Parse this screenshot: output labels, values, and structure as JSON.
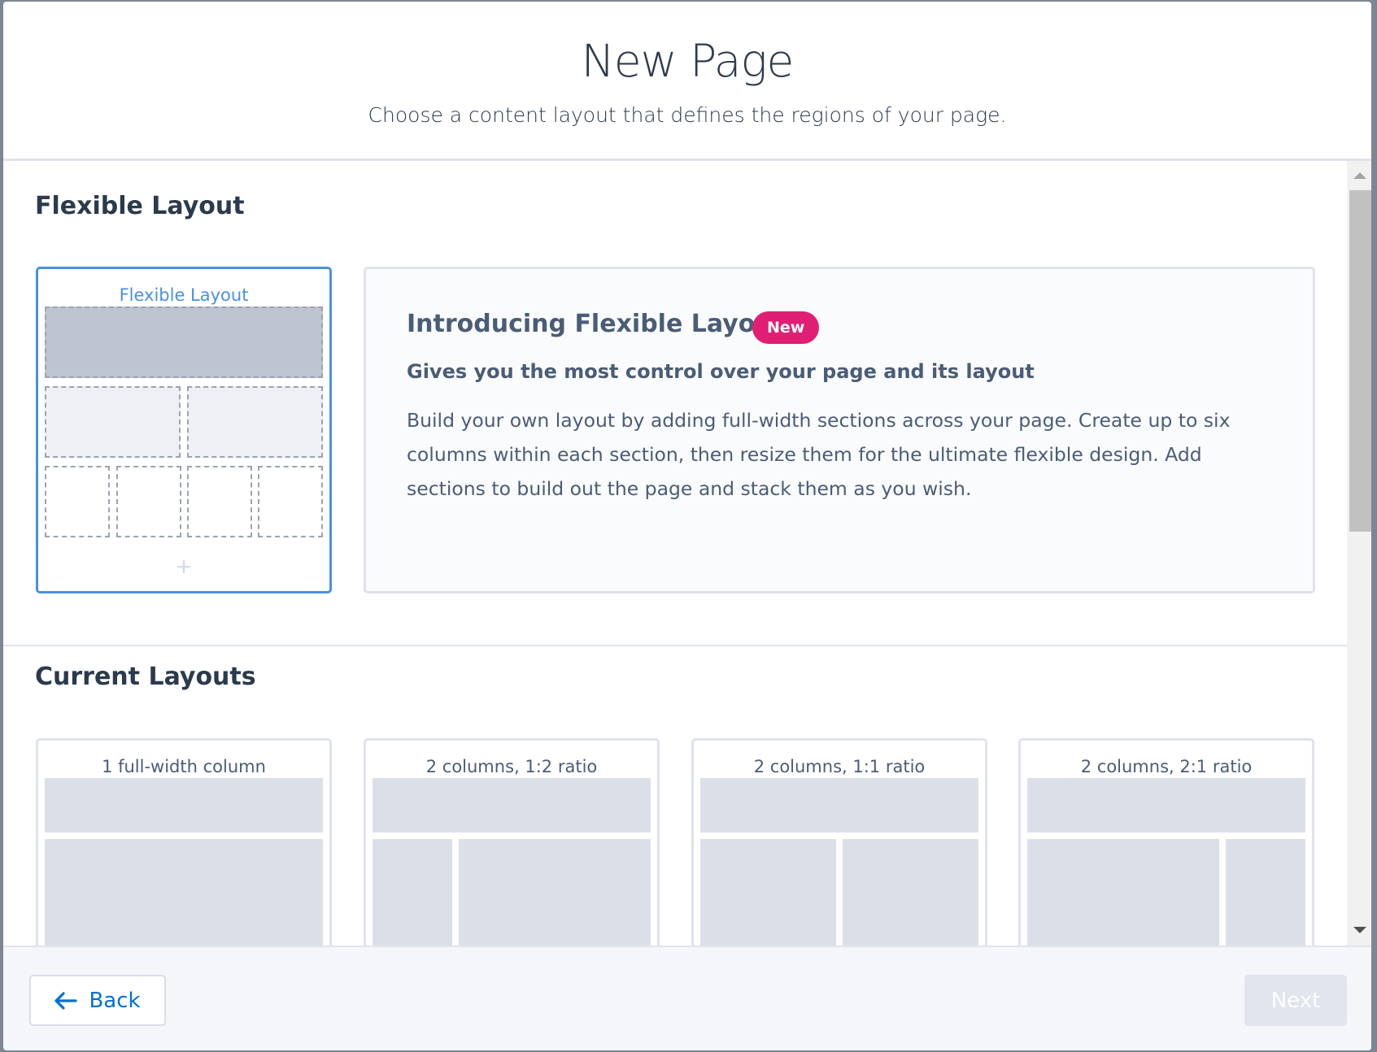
{
  "header": {
    "title": "New Page",
    "subtitle": "Choose a content layout that defines the regions of your page."
  },
  "flexible": {
    "section_title": "Flexible Layout",
    "card_label": "Flexible Layout",
    "intro_title": "Introducing Flexible Layouts",
    "badge": "New",
    "intro_subtitle": "Gives you the most control over your page and its layout",
    "intro_desc": "Build your own layout by adding full-width sections across your page. Create up to six columns within each section, then resize them for the ultimate flexible design. Add sections to build out the page and stack them as you wish."
  },
  "current": {
    "section_title": "Current Layouts",
    "layouts": [
      {
        "label": "1 full-width column"
      },
      {
        "label": "2 columns, 1:2 ratio"
      },
      {
        "label": "2 columns, 1:1 ratio"
      },
      {
        "label": "2 columns, 2:1 ratio"
      }
    ]
  },
  "footer": {
    "back_label": "Back",
    "next_label": "Next"
  },
  "colors": {
    "accent": "#4a90e2",
    "badge": "#e01f74",
    "link": "#0070d2"
  }
}
